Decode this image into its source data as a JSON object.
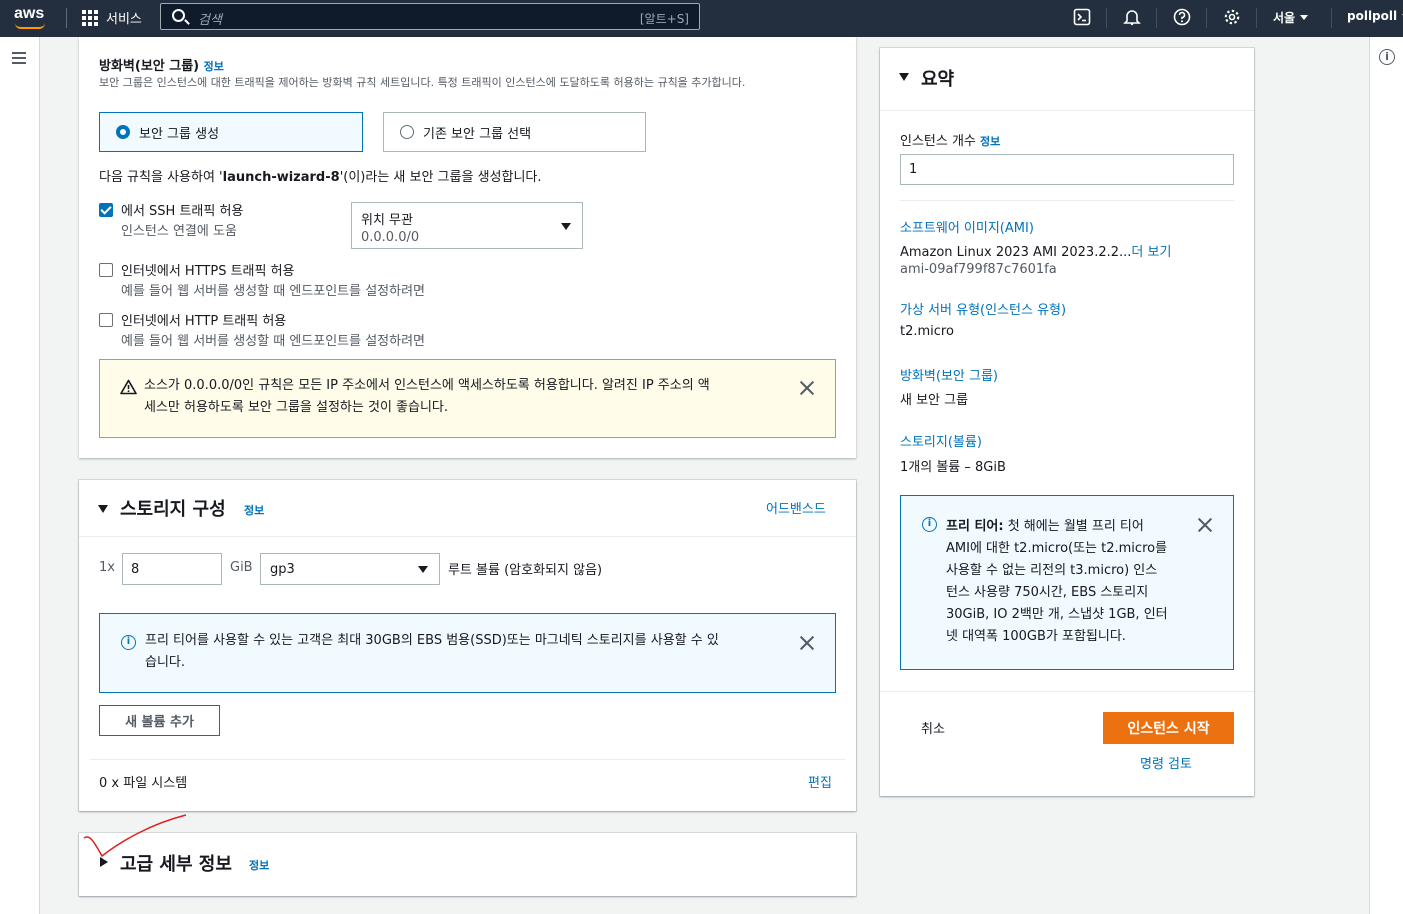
{
  "nav": {
    "logo": "aws",
    "services": "서비스",
    "search_placeholder": "검색",
    "search_shortcut": "[알트+S]",
    "region": "서울",
    "user": "pollpoll"
  },
  "firewall": {
    "title": "방화벽(보안 그룹)",
    "info": "정보",
    "description": "보안 그룹은 인스턴스에 대한 트래픽을 제어하는 방화벽 규칙 세트입니다. 특정 트래픽이 인스턴스에 도달하도록 허용하는 규칙을 추가합니다.",
    "option_create": "보안 그룹 생성",
    "option_existing": "기존 보안 그룹 선택",
    "rule_prefix": "다음 규칙을 사용하여 '",
    "rule_name": "launch-wizard-8",
    "rule_suffix": "'(이)라는 새 보안 그룹을 생성합니다.",
    "ssh_label": "에서 SSH 트래픽 허용",
    "ssh_sub": "인스턴스 연결에 도움",
    "ssh_source": "위치 무관",
    "ssh_source_sub": "0.0.0.0/0",
    "https_label": "인터넷에서 HTTPS 트래픽 허용",
    "https_sub": "예를 들어 웹 서버를 생성할 때 엔드포인트를 설정하려면",
    "http_label": "인터넷에서 HTTP 트래픽 허용",
    "http_sub": "예를 들어 웹 서버를 생성할 때 엔드포인트를 설정하려면",
    "warning_line1": "소스가 0.0.0.0/0인 규칙은 모든 IP 주소에서 인스턴스에 액세스하도록 허용합니다. 알려진 IP 주소의 액",
    "warning_line2": "세스만 허용하도록 보안 그룹을 설정하는 것이 좋습니다."
  },
  "storage": {
    "title": "스토리지 구성",
    "info": "정보",
    "advanced": "어드밴스드",
    "count": "1x",
    "size": "8",
    "unit": "GiB",
    "type": "gp3",
    "root_label": "루트 볼륨  (암호화되지 않음)",
    "free_tier_line1": "프리 티어를 사용할 수 있는 고객은 최대 30GB의 EBS 범용(SSD)또는 마그네틱 스토리지를 사용할 수 있",
    "free_tier_line2": "습니다.",
    "add_volume": "새 볼륨 추가",
    "fs": "0 x 파일 시스템",
    "edit": "편집"
  },
  "advanced": {
    "title": "고급 세부 정보",
    "info": "정보"
  },
  "summary": {
    "title": "요약",
    "instance_count_label": "인스턴스 개수",
    "info": "정보",
    "instance_count": "1",
    "ami_title": "소프트웨어 이미지(AMI)",
    "ami_value": "Amazon Linux 2023 AMI 2023.2.2...",
    "ami_more": "더 보기",
    "ami_id": "ami-09af799f87c7601fa",
    "type_title": "가상 서버 유형(인스턴스 유형)",
    "type_value": "t2.micro",
    "fw_title": "방화벽(보안 그룹)",
    "fw_value": "새 보안 그룹",
    "storage_title": "스토리지(볼륨)",
    "storage_value": "1개의 볼륨 – 8GiB",
    "free_tier_bold": "프리 티어:",
    "free_tier_l1": " 첫 해에는 월별 프리 티어",
    "free_tier_l2": "AMI에 대한 t2.micro(또는 t2.micro를",
    "free_tier_l3": "사용할 수 없는 리전의 t3.micro) 인스",
    "free_tier_l4": "턴스 사용량 750시간, EBS 스토리지",
    "free_tier_l5": "30GiB, IO 2백만 개, 스냅샷 1GB, 인터",
    "free_tier_l6": "넷 대역폭 100GB가 포함됩니다.",
    "cancel": "취소",
    "launch": "인스턴스 시작",
    "review": "명령 검토"
  },
  "colors": {
    "accent": "#0073bb",
    "primary_button": "#ec7211",
    "nav_bg": "#232f3e",
    "annotation": "#e02020"
  }
}
